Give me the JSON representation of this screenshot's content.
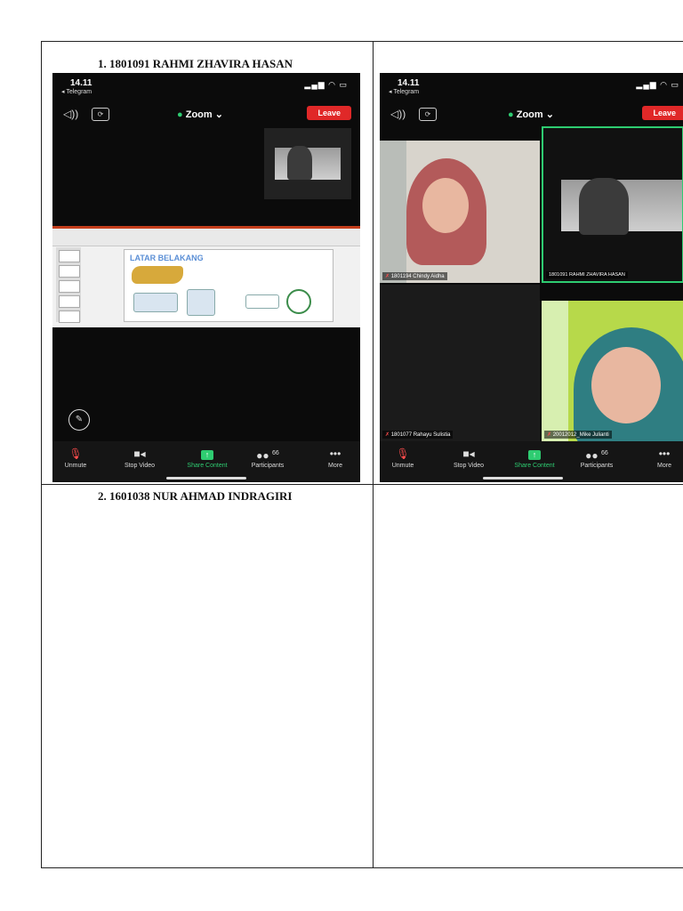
{
  "captions": {
    "first": "1.  1801091 RAHMI ZHAVIRA HASAN",
    "second": "2.  1601038 NUR AHMAD INDRAGIRI"
  },
  "phone": {
    "time": "14.11",
    "back_app": "◂ Telegram",
    "meeting_title": "Zoom",
    "leave_label": "Leave"
  },
  "toolbar": {
    "unmute": "Unmute",
    "stop_video": "Stop Video",
    "share_content": "Share Content",
    "participants": "Participants",
    "participants_count": "66",
    "more": "More"
  },
  "slide": {
    "title": "LATAR BELAKANG"
  },
  "participants": {
    "tile1": "1801194 Chindy Aidha",
    "tile2": "1801091 RAHMI ZHAVIRA HASAN",
    "tile3": "1801077 Rahayu Sulistia",
    "tile4": "20012012_Mike Julianti"
  },
  "colors": {
    "leave": "#e02828",
    "accent_green": "#2ecc71",
    "background": "#0b0b0b"
  }
}
